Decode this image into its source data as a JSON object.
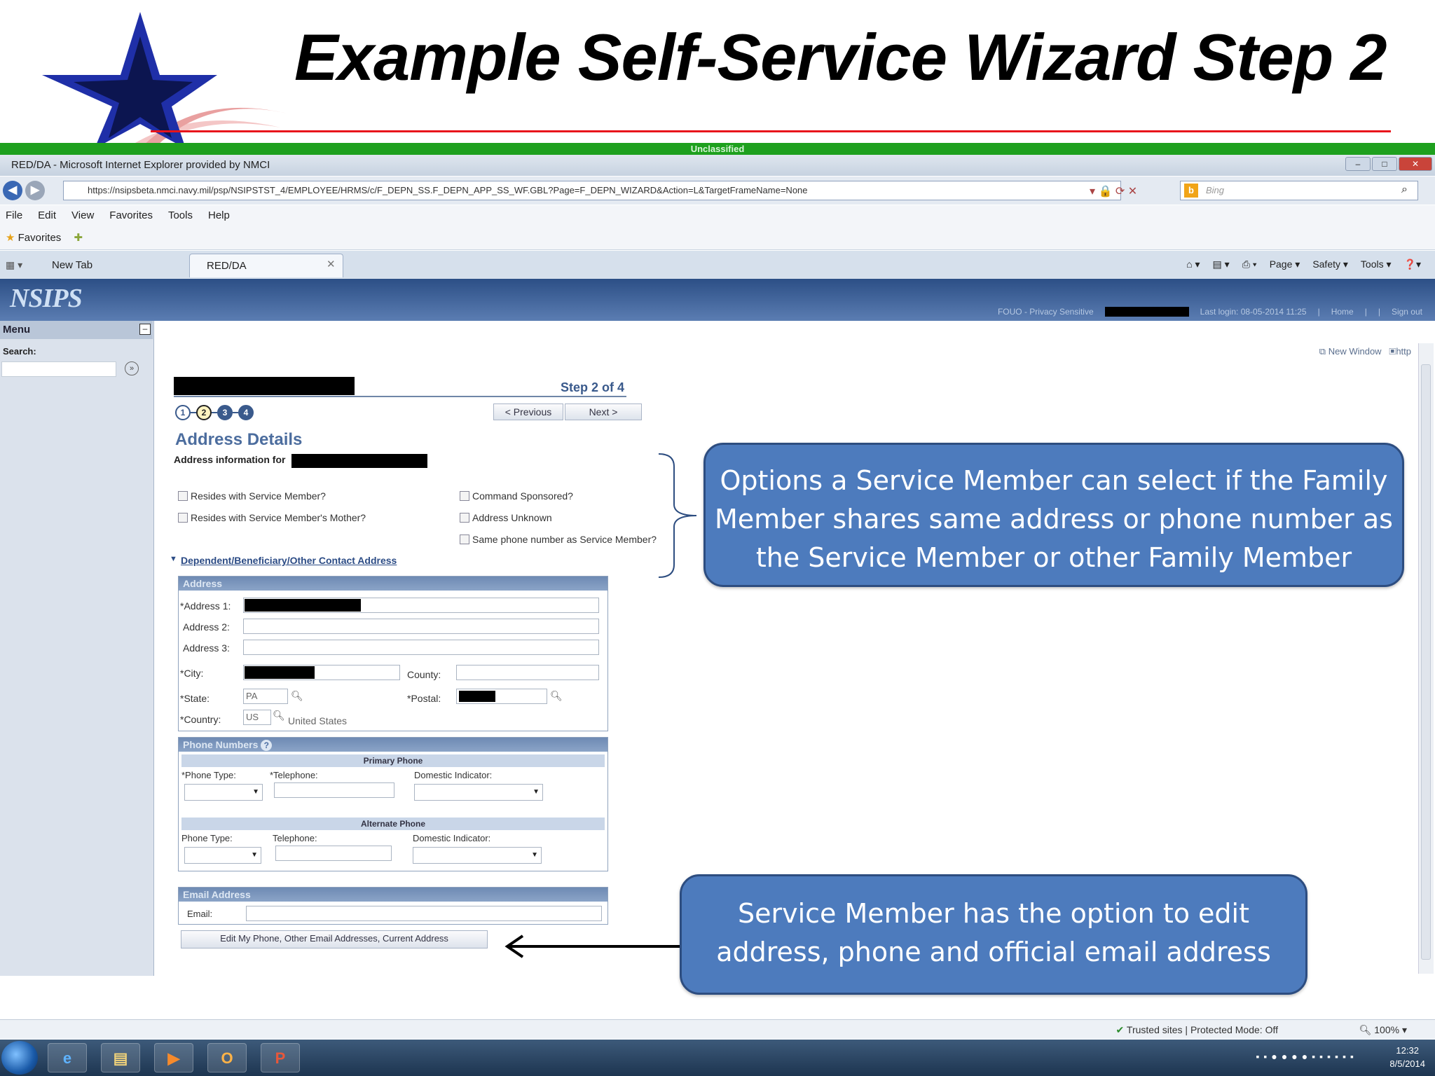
{
  "slide": {
    "title": "Example Self-Service Wizard Step 2",
    "brand_colors": {
      "star_blue": "#1f2fa8",
      "rule_red": "#e8141b",
      "callout_fill": "#4d7bbd"
    }
  },
  "classification": "Unclassified",
  "browser": {
    "window_title": "RED/DA - Microsoft Internet Explorer provided by NMCI",
    "url": "https://nsipsbeta.nmci.navy.mil/psp/NSIPSTST_4/EMPLOYEE/HRMS/c/F_DEPN_SS.F_DEPN_APP_SS_WF.GBL?Page=F_DEPN_WIZARD&Action=L&TargetFrameName=None",
    "search_placeholder": "Bing",
    "menu": [
      "File",
      "Edit",
      "View",
      "Favorites",
      "Tools",
      "Help"
    ],
    "favorites_label": "Favorites",
    "tabs": [
      {
        "label": "New Tab"
      },
      {
        "label": "RED/DA"
      }
    ],
    "command_bar": [
      "Page ▾",
      "Safety ▾",
      "Tools ▾"
    ],
    "status": "Trusted sites | Protected Mode: Off",
    "zoom": "100%",
    "clock_time": "12:32",
    "clock_date": "8/5/2014"
  },
  "app": {
    "logo": "NSIPS",
    "banner_notice": "FOUO - Privacy Sensitive",
    "last_login": "Last login: 08-05-2014 11:25",
    "home": "Home",
    "sign_out": "Sign out",
    "left_menu": {
      "header": "Menu",
      "search_label": "Search:"
    },
    "new_window": "New Window",
    "http_link": "http"
  },
  "wizard": {
    "step_label": "Step 2 of 4",
    "steps": [
      "1",
      "2",
      "3",
      "4"
    ],
    "current_step": 2,
    "prev_label": "< Previous",
    "next_label": "Next >",
    "section_title": "Address Details",
    "address_info_label": "Address information for",
    "checkboxes_left": [
      "Resides with Service Member?",
      "Resides with Service Member's Mother?"
    ],
    "checkboxes_right": [
      "Command Sponsored?",
      "Address Unknown",
      "Same phone number as Service Member?"
    ],
    "dependent_link": "Dependent/Beneficiary/Other Contact Address",
    "address_panel": {
      "header": "Address",
      "address1_label": "*Address 1:",
      "address2_label": "Address 2:",
      "address3_label": "Address 3:",
      "city_label": "*City:",
      "county_label": "County:",
      "state_label": "*State:",
      "state_value": "PA",
      "postal_label": "*Postal:",
      "country_label": "*Country:",
      "country_value": "US",
      "country_name": "United States"
    },
    "phone_panel": {
      "header": "Phone Numbers",
      "primary_title": "Primary Phone",
      "alternate_title": "Alternate Phone",
      "primary_type_label": "*Phone Type:",
      "primary_tel_label": "*Telephone:",
      "primary_dom_label": "Domestic Indicator:",
      "alt_type_label": "Phone Type:",
      "alt_tel_label": "Telephone:",
      "alt_dom_label": "Domestic Indicator:"
    },
    "email_panel": {
      "header": "Email Address",
      "email_label": "Email:"
    },
    "edit_button": "Edit My Phone, Other Email Addresses, Current Address"
  },
  "callouts": {
    "options_text": "Options a Service Member can select if the Family Member shares same address or phone number as the Service Member or other Family Member",
    "edit_text": "Service Member has the option to edit address, phone and official email  address"
  }
}
